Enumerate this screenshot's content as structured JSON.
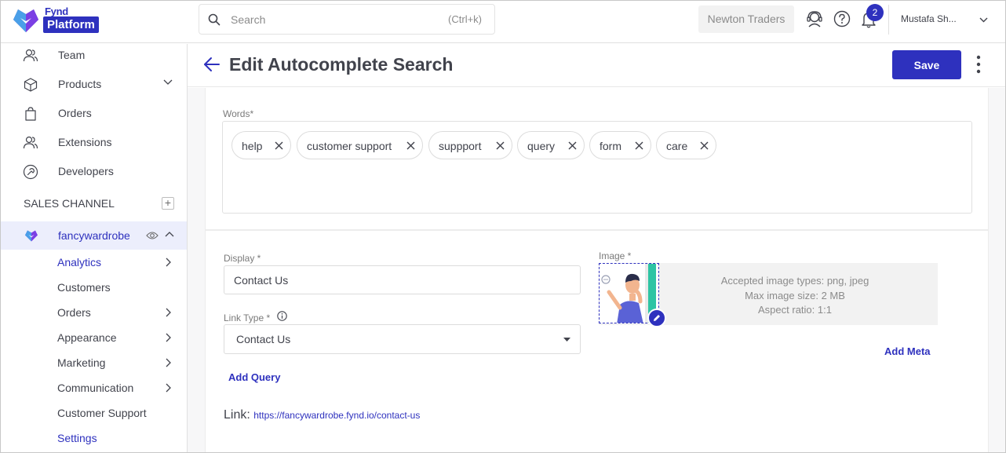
{
  "app": {
    "logo_top": "Fynd",
    "logo_box": "Platform",
    "brand_color": "#2e31be"
  },
  "search": {
    "placeholder": "Search",
    "shortcut": "(Ctrl+k)"
  },
  "topbar": {
    "company": "Newton Traders",
    "notification_count": "2",
    "user_name": "Mustafa Sh..."
  },
  "sidebar": {
    "items": [
      {
        "label": "Team",
        "icon": "team-icon"
      },
      {
        "label": "Products",
        "icon": "products-icon"
      },
      {
        "label": "Orders",
        "icon": "orders-icon"
      },
      {
        "label": "Extensions",
        "icon": "extensions-icon"
      },
      {
        "label": "Developers",
        "icon": "developers-icon"
      }
    ],
    "section_label": "SALES CHANNEL",
    "section_add": "+",
    "channel": {
      "label": "fancywardrobe"
    },
    "sub_items": [
      {
        "label": "Analytics"
      },
      {
        "label": "Customers"
      },
      {
        "label": "Orders"
      },
      {
        "label": "Appearance"
      },
      {
        "label": "Marketing"
      },
      {
        "label": "Communication"
      },
      {
        "label": "Customer Support"
      },
      {
        "label": "Settings"
      }
    ]
  },
  "header": {
    "title": "Edit Autocomplete Search",
    "save_label": "Save"
  },
  "words": {
    "label": "Words*",
    "chips": [
      "help",
      "customer support",
      "suppport",
      "query",
      "form",
      "care"
    ]
  },
  "form": {
    "display_label": "Display *",
    "display_value": "Contact Us",
    "link_type_label": "Link Type *",
    "link_type_value": "Contact Us",
    "add_query": "Add Query",
    "link_prefix": "Link:",
    "link_url": "https://fancywardrobe.fynd.io/contact-us",
    "image_label": "Image *",
    "image_info": [
      "Accepted image types: png, jpeg",
      "Max image size: 2 MB",
      "Aspect ratio: 1:1"
    ],
    "add_meta": "Add Meta"
  }
}
